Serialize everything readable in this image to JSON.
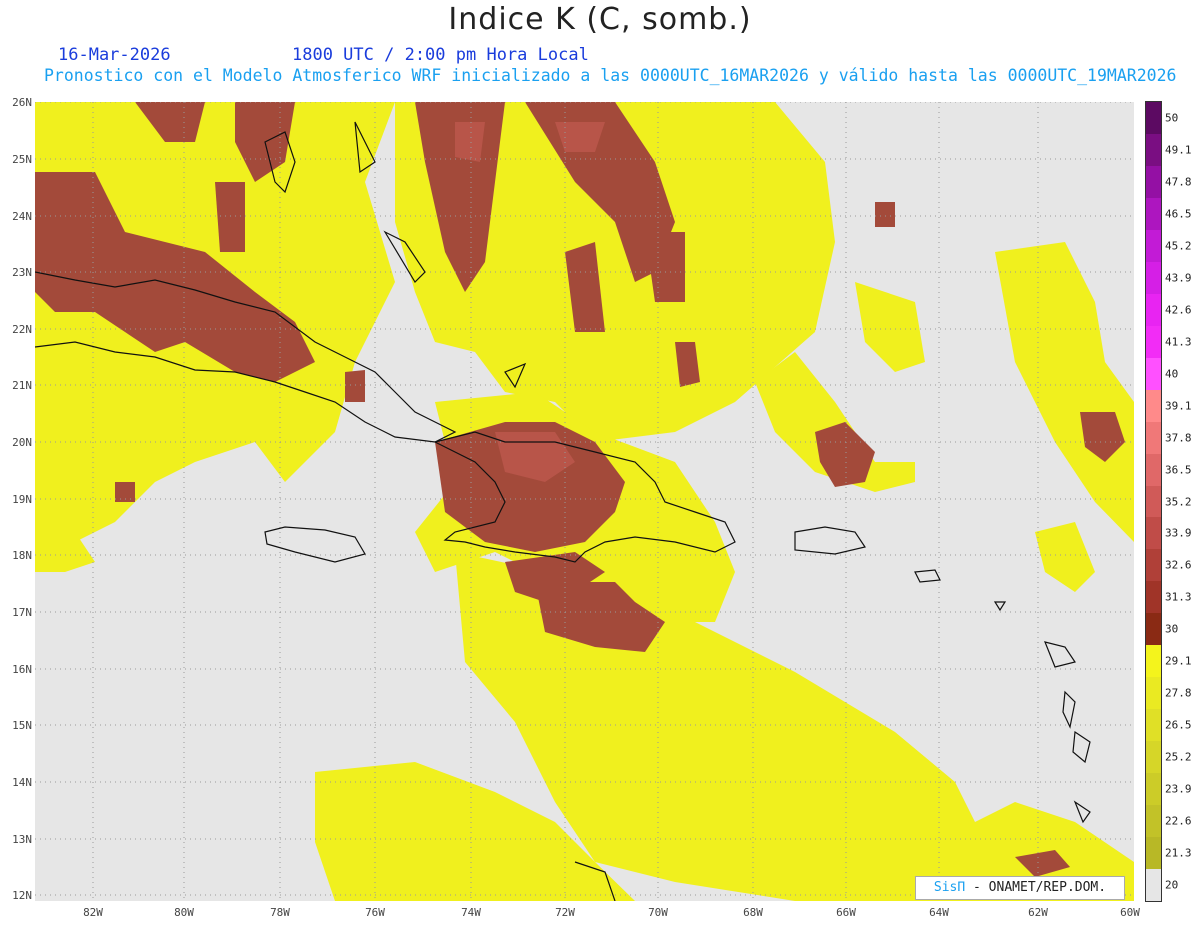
{
  "title": "Indice K (C, somb.)",
  "date": "16-Mar-2026",
  "time": "1800 UTC / 2:00 pm Hora Local",
  "subtitle": "Pronostico con el Modelo Atmosferico WRF inicializado a las 0000UTC_16MAR2026 y válido hasta las  0000UTC_19MAR2026",
  "credit": {
    "sis": "SisΠ",
    "rest": " - ONAMET/REP.DOM."
  },
  "lat_labels": [
    "26N",
    "25N",
    "24N",
    "23N",
    "22N",
    "21N",
    "20N",
    "19N",
    "18N",
    "17N",
    "16N",
    "15N",
    "14N",
    "13N",
    "12N"
  ],
  "lon_labels": [
    "82W",
    "80W",
    "78W",
    "76W",
    "74W",
    "72W",
    "70W",
    "68W",
    "66W",
    "64W",
    "62W",
    "60W"
  ],
  "colorbar": {
    "labels": [
      "50",
      "49.1",
      "47.8",
      "46.5",
      "45.2",
      "43.9",
      "42.6",
      "41.3",
      "40",
      "39.1",
      "37.8",
      "36.5",
      "35.2",
      "33.9",
      "32.6",
      "31.3",
      "30",
      "29.1",
      "27.8",
      "26.5",
      "25.2",
      "23.9",
      "22.6",
      "21.3",
      "20"
    ],
    "colors": [
      "#5c0a62",
      "#7a0e82",
      "#9410a4",
      "#ad16bf",
      "#c21bd6",
      "#d51fe6",
      "#e824f2",
      "#f22cf6",
      "#ff50ff",
      "#ff8a8a",
      "#f07878",
      "#e06868",
      "#d05a58",
      "#c04c48",
      "#b04038",
      "#a03428",
      "#8a2a14",
      "#f4f41c",
      "#eaea22",
      "#e0e026",
      "#d6d628",
      "#cccc28",
      "#c2c228",
      "#b8b826",
      "#e6e6e6"
    ]
  },
  "colors": {
    "background": "#e6e6e6",
    "yellow": "#f0f01e",
    "brown": "#a34a3a",
    "brown_light": "#c05a50",
    "coast": "#111111",
    "grid": "#999999"
  }
}
